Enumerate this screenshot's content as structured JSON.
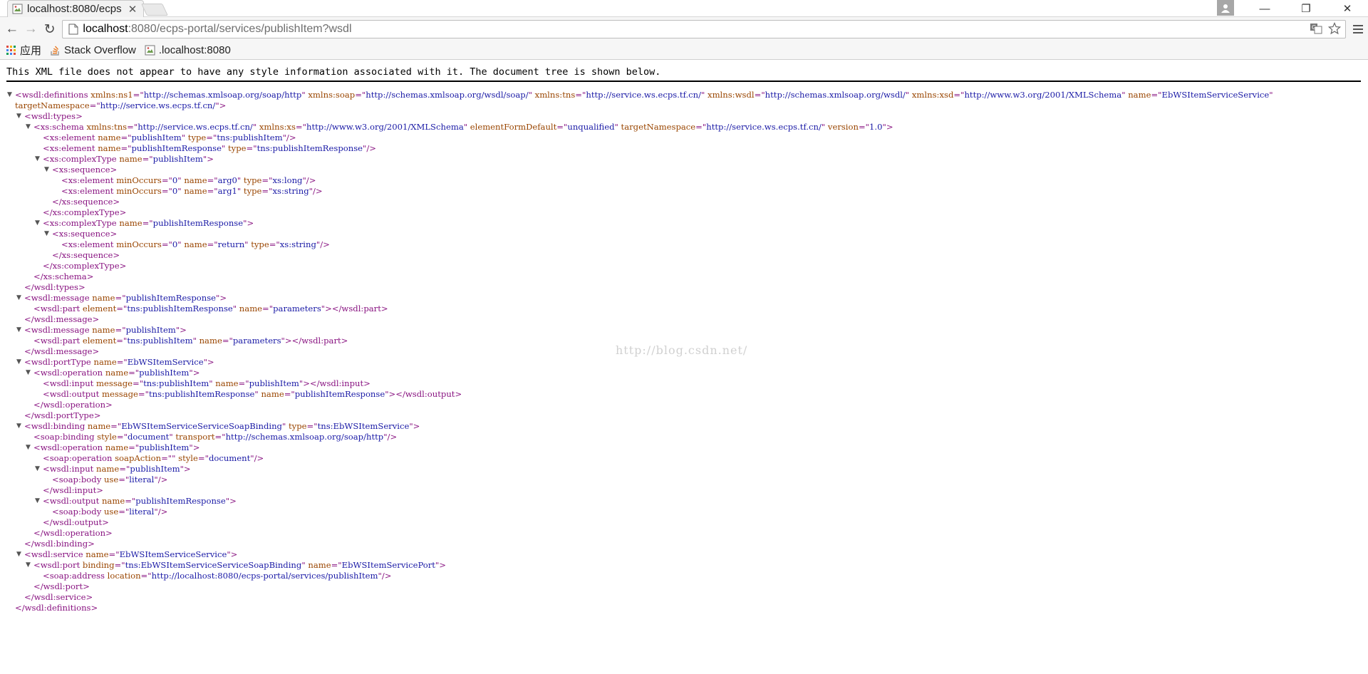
{
  "tab": {
    "title": "localhost:8080/ecps",
    "close_glyph": "✕"
  },
  "window_controls": {
    "minimize": "—",
    "restore": "❐",
    "close": "✕"
  },
  "toolbar": {
    "back_glyph": "←",
    "forward_glyph": "→",
    "reload_glyph": "↻",
    "url_host": "localhost",
    "url_path": ":8080/ecps-portal/services/publishItem?wsdl"
  },
  "bookmarks": [
    {
      "label": "应用",
      "icon": "apps-grid-icon"
    },
    {
      "label": "Stack Overflow",
      "icon": "stackoverflow-icon"
    },
    {
      "label": ".localhost:8080",
      "icon": "broken-image-icon"
    }
  ],
  "notice": "This XML file does not appear to have any style information associated with it. The document tree is shown below.",
  "watermark": "http://blog.csdn.net/",
  "colors": {
    "tag": "#881280",
    "attr_name": "#994500",
    "attr_value": "#1a1aa6"
  },
  "xml_lines": [
    {
      "indent": 0,
      "toggle": true,
      "parts": [
        [
          "t",
          "<wsdl:definitions"
        ],
        [
          "n",
          " xmlns:ns1"
        ],
        [
          "t",
          "=\""
        ],
        [
          "v",
          "http://schemas.xmlsoap.org/soap/http"
        ],
        [
          "t",
          "\""
        ],
        [
          "n",
          " xmlns:soap"
        ],
        [
          "t",
          "=\""
        ],
        [
          "v",
          "http://schemas.xmlsoap.org/wsdl/soap/"
        ],
        [
          "t",
          "\""
        ],
        [
          "n",
          " xmlns:tns"
        ],
        [
          "t",
          "=\""
        ],
        [
          "v",
          "http://service.ws.ecps.tf.cn/"
        ],
        [
          "t",
          "\""
        ],
        [
          "n",
          " xmlns:wsdl"
        ],
        [
          "t",
          "=\""
        ],
        [
          "v",
          "http://schemas.xmlsoap.org/wsdl/"
        ],
        [
          "t",
          "\""
        ],
        [
          "n",
          " xmlns:xsd"
        ],
        [
          "t",
          "=\""
        ],
        [
          "v",
          "http://www.w3.org/2001/XMLSchema"
        ],
        [
          "t",
          "\""
        ],
        [
          "n",
          " name"
        ],
        [
          "t",
          "=\""
        ],
        [
          "v",
          "EbWSItemServiceService"
        ],
        [
          "t",
          "\""
        ]
      ]
    },
    {
      "indent": 0,
      "toggle": false,
      "parts": [
        [
          "n",
          "targetNamespace"
        ],
        [
          "t",
          "=\""
        ],
        [
          "v",
          "http://service.ws.ecps.tf.cn/"
        ],
        [
          "t",
          "\">"
        ]
      ]
    },
    {
      "indent": 1,
      "toggle": true,
      "parts": [
        [
          "t",
          "<wsdl:types>"
        ]
      ]
    },
    {
      "indent": 2,
      "toggle": true,
      "parts": [
        [
          "t",
          "<xs:schema"
        ],
        [
          "n",
          " xmlns:tns"
        ],
        [
          "t",
          "=\""
        ],
        [
          "v",
          "http://service.ws.ecps.tf.cn/"
        ],
        [
          "t",
          "\""
        ],
        [
          "n",
          " xmlns:xs"
        ],
        [
          "t",
          "=\""
        ],
        [
          "v",
          "http://www.w3.org/2001/XMLSchema"
        ],
        [
          "t",
          "\""
        ],
        [
          "n",
          " elementFormDefault"
        ],
        [
          "t",
          "=\""
        ],
        [
          "v",
          "unqualified"
        ],
        [
          "t",
          "\""
        ],
        [
          "n",
          " targetNamespace"
        ],
        [
          "t",
          "=\""
        ],
        [
          "v",
          "http://service.ws.ecps.tf.cn/"
        ],
        [
          "t",
          "\""
        ],
        [
          "n",
          " version"
        ],
        [
          "t",
          "=\""
        ],
        [
          "v",
          "1.0"
        ],
        [
          "t",
          "\">"
        ]
      ]
    },
    {
      "indent": 3,
      "toggle": false,
      "parts": [
        [
          "t",
          "<xs:element"
        ],
        [
          "n",
          " name"
        ],
        [
          "t",
          "=\""
        ],
        [
          "v",
          "publishItem"
        ],
        [
          "t",
          "\""
        ],
        [
          "n",
          " type"
        ],
        [
          "t",
          "=\""
        ],
        [
          "v",
          "tns:publishItem"
        ],
        [
          "t",
          "\"/>"
        ]
      ]
    },
    {
      "indent": 3,
      "toggle": false,
      "parts": [
        [
          "t",
          "<xs:element"
        ],
        [
          "n",
          " name"
        ],
        [
          "t",
          "=\""
        ],
        [
          "v",
          "publishItemResponse"
        ],
        [
          "t",
          "\""
        ],
        [
          "n",
          " type"
        ],
        [
          "t",
          "=\""
        ],
        [
          "v",
          "tns:publishItemResponse"
        ],
        [
          "t",
          "\"/>"
        ]
      ]
    },
    {
      "indent": 3,
      "toggle": true,
      "parts": [
        [
          "t",
          "<xs:complexType"
        ],
        [
          "n",
          " name"
        ],
        [
          "t",
          "=\""
        ],
        [
          "v",
          "publishItem"
        ],
        [
          "t",
          "\">"
        ]
      ]
    },
    {
      "indent": 4,
      "toggle": true,
      "parts": [
        [
          "t",
          "<xs:sequence>"
        ]
      ]
    },
    {
      "indent": 5,
      "toggle": false,
      "parts": [
        [
          "t",
          "<xs:element"
        ],
        [
          "n",
          " minOccurs"
        ],
        [
          "t",
          "=\""
        ],
        [
          "v",
          "0"
        ],
        [
          "t",
          "\""
        ],
        [
          "n",
          " name"
        ],
        [
          "t",
          "=\""
        ],
        [
          "v",
          "arg0"
        ],
        [
          "t",
          "\""
        ],
        [
          "n",
          " type"
        ],
        [
          "t",
          "=\""
        ],
        [
          "v",
          "xs:long"
        ],
        [
          "t",
          "\"/>"
        ]
      ]
    },
    {
      "indent": 5,
      "toggle": false,
      "parts": [
        [
          "t",
          "<xs:element"
        ],
        [
          "n",
          " minOccurs"
        ],
        [
          "t",
          "=\""
        ],
        [
          "v",
          "0"
        ],
        [
          "t",
          "\""
        ],
        [
          "n",
          " name"
        ],
        [
          "t",
          "=\""
        ],
        [
          "v",
          "arg1"
        ],
        [
          "t",
          "\""
        ],
        [
          "n",
          " type"
        ],
        [
          "t",
          "=\""
        ],
        [
          "v",
          "xs:string"
        ],
        [
          "t",
          "\"/>"
        ]
      ]
    },
    {
      "indent": 4,
      "toggle": false,
      "parts": [
        [
          "t",
          "</xs:sequence>"
        ]
      ]
    },
    {
      "indent": 3,
      "toggle": false,
      "parts": [
        [
          "t",
          "</xs:complexType>"
        ]
      ]
    },
    {
      "indent": 3,
      "toggle": true,
      "parts": [
        [
          "t",
          "<xs:complexType"
        ],
        [
          "n",
          " name"
        ],
        [
          "t",
          "=\""
        ],
        [
          "v",
          "publishItemResponse"
        ],
        [
          "t",
          "\">"
        ]
      ]
    },
    {
      "indent": 4,
      "toggle": true,
      "parts": [
        [
          "t",
          "<xs:sequence>"
        ]
      ]
    },
    {
      "indent": 5,
      "toggle": false,
      "parts": [
        [
          "t",
          "<xs:element"
        ],
        [
          "n",
          " minOccurs"
        ],
        [
          "t",
          "=\""
        ],
        [
          "v",
          "0"
        ],
        [
          "t",
          "\""
        ],
        [
          "n",
          " name"
        ],
        [
          "t",
          "=\""
        ],
        [
          "v",
          "return"
        ],
        [
          "t",
          "\""
        ],
        [
          "n",
          " type"
        ],
        [
          "t",
          "=\""
        ],
        [
          "v",
          "xs:string"
        ],
        [
          "t",
          "\"/>"
        ]
      ]
    },
    {
      "indent": 4,
      "toggle": false,
      "parts": [
        [
          "t",
          "</xs:sequence>"
        ]
      ]
    },
    {
      "indent": 3,
      "toggle": false,
      "parts": [
        [
          "t",
          "</xs:complexType>"
        ]
      ]
    },
    {
      "indent": 2,
      "toggle": false,
      "parts": [
        [
          "t",
          "</xs:schema>"
        ]
      ]
    },
    {
      "indent": 1,
      "toggle": false,
      "parts": [
        [
          "t",
          "</wsdl:types>"
        ]
      ]
    },
    {
      "indent": 1,
      "toggle": true,
      "parts": [
        [
          "t",
          "<wsdl:message"
        ],
        [
          "n",
          " name"
        ],
        [
          "t",
          "=\""
        ],
        [
          "v",
          "publishItemResponse"
        ],
        [
          "t",
          "\">"
        ]
      ]
    },
    {
      "indent": 2,
      "toggle": false,
      "parts": [
        [
          "t",
          "<wsdl:part"
        ],
        [
          "n",
          " element"
        ],
        [
          "t",
          "=\""
        ],
        [
          "v",
          "tns:publishItemResponse"
        ],
        [
          "t",
          "\""
        ],
        [
          "n",
          " name"
        ],
        [
          "t",
          "=\""
        ],
        [
          "v",
          "parameters"
        ],
        [
          "t",
          "\"></wsdl:part>"
        ]
      ]
    },
    {
      "indent": 1,
      "toggle": false,
      "parts": [
        [
          "t",
          "</wsdl:message>"
        ]
      ]
    },
    {
      "indent": 1,
      "toggle": true,
      "parts": [
        [
          "t",
          "<wsdl:message"
        ],
        [
          "n",
          " name"
        ],
        [
          "t",
          "=\""
        ],
        [
          "v",
          "publishItem"
        ],
        [
          "t",
          "\">"
        ]
      ]
    },
    {
      "indent": 2,
      "toggle": false,
      "parts": [
        [
          "t",
          "<wsdl:part"
        ],
        [
          "n",
          " element"
        ],
        [
          "t",
          "=\""
        ],
        [
          "v",
          "tns:publishItem"
        ],
        [
          "t",
          "\""
        ],
        [
          "n",
          " name"
        ],
        [
          "t",
          "=\""
        ],
        [
          "v",
          "parameters"
        ],
        [
          "t",
          "\"></wsdl:part>"
        ]
      ]
    },
    {
      "indent": 1,
      "toggle": false,
      "parts": [
        [
          "t",
          "</wsdl:message>"
        ]
      ]
    },
    {
      "indent": 1,
      "toggle": true,
      "parts": [
        [
          "t",
          "<wsdl:portType"
        ],
        [
          "n",
          " name"
        ],
        [
          "t",
          "=\""
        ],
        [
          "v",
          "EbWSItemService"
        ],
        [
          "t",
          "\">"
        ]
      ]
    },
    {
      "indent": 2,
      "toggle": true,
      "parts": [
        [
          "t",
          "<wsdl:operation"
        ],
        [
          "n",
          " name"
        ],
        [
          "t",
          "=\""
        ],
        [
          "v",
          "publishItem"
        ],
        [
          "t",
          "\">"
        ]
      ]
    },
    {
      "indent": 3,
      "toggle": false,
      "parts": [
        [
          "t",
          "<wsdl:input"
        ],
        [
          "n",
          " message"
        ],
        [
          "t",
          "=\""
        ],
        [
          "v",
          "tns:publishItem"
        ],
        [
          "t",
          "\""
        ],
        [
          "n",
          " name"
        ],
        [
          "t",
          "=\""
        ],
        [
          "v",
          "publishItem"
        ],
        [
          "t",
          "\"></wsdl:input>"
        ]
      ]
    },
    {
      "indent": 3,
      "toggle": false,
      "parts": [
        [
          "t",
          "<wsdl:output"
        ],
        [
          "n",
          " message"
        ],
        [
          "t",
          "=\""
        ],
        [
          "v",
          "tns:publishItemResponse"
        ],
        [
          "t",
          "\""
        ],
        [
          "n",
          " name"
        ],
        [
          "t",
          "=\""
        ],
        [
          "v",
          "publishItemResponse"
        ],
        [
          "t",
          "\"></wsdl:output>"
        ]
      ]
    },
    {
      "indent": 2,
      "toggle": false,
      "parts": [
        [
          "t",
          "</wsdl:operation>"
        ]
      ]
    },
    {
      "indent": 1,
      "toggle": false,
      "parts": [
        [
          "t",
          "</wsdl:portType>"
        ]
      ]
    },
    {
      "indent": 1,
      "toggle": true,
      "parts": [
        [
          "t",
          "<wsdl:binding"
        ],
        [
          "n",
          " name"
        ],
        [
          "t",
          "=\""
        ],
        [
          "v",
          "EbWSItemServiceServiceSoapBinding"
        ],
        [
          "t",
          "\""
        ],
        [
          "n",
          " type"
        ],
        [
          "t",
          "=\""
        ],
        [
          "v",
          "tns:EbWSItemService"
        ],
        [
          "t",
          "\">"
        ]
      ]
    },
    {
      "indent": 2,
      "toggle": false,
      "parts": [
        [
          "t",
          "<soap:binding"
        ],
        [
          "n",
          " style"
        ],
        [
          "t",
          "=\""
        ],
        [
          "v",
          "document"
        ],
        [
          "t",
          "\""
        ],
        [
          "n",
          " transport"
        ],
        [
          "t",
          "=\""
        ],
        [
          "v",
          "http://schemas.xmlsoap.org/soap/http"
        ],
        [
          "t",
          "\"/>"
        ]
      ]
    },
    {
      "indent": 2,
      "toggle": true,
      "parts": [
        [
          "t",
          "<wsdl:operation"
        ],
        [
          "n",
          " name"
        ],
        [
          "t",
          "=\""
        ],
        [
          "v",
          "publishItem"
        ],
        [
          "t",
          "\">"
        ]
      ]
    },
    {
      "indent": 3,
      "toggle": false,
      "parts": [
        [
          "t",
          "<soap:operation"
        ],
        [
          "n",
          " soapAction"
        ],
        [
          "t",
          "=\"\""
        ],
        [
          "n",
          " style"
        ],
        [
          "t",
          "=\""
        ],
        [
          "v",
          "document"
        ],
        [
          "t",
          "\"/>"
        ]
      ]
    },
    {
      "indent": 3,
      "toggle": true,
      "parts": [
        [
          "t",
          "<wsdl:input"
        ],
        [
          "n",
          " name"
        ],
        [
          "t",
          "=\""
        ],
        [
          "v",
          "publishItem"
        ],
        [
          "t",
          "\">"
        ]
      ]
    },
    {
      "indent": 4,
      "toggle": false,
      "parts": [
        [
          "t",
          "<soap:body"
        ],
        [
          "n",
          " use"
        ],
        [
          "t",
          "=\""
        ],
        [
          "v",
          "literal"
        ],
        [
          "t",
          "\"/>"
        ]
      ]
    },
    {
      "indent": 3,
      "toggle": false,
      "parts": [
        [
          "t",
          "</wsdl:input>"
        ]
      ]
    },
    {
      "indent": 3,
      "toggle": true,
      "parts": [
        [
          "t",
          "<wsdl:output"
        ],
        [
          "n",
          " name"
        ],
        [
          "t",
          "=\""
        ],
        [
          "v",
          "publishItemResponse"
        ],
        [
          "t",
          "\">"
        ]
      ]
    },
    {
      "indent": 4,
      "toggle": false,
      "parts": [
        [
          "t",
          "<soap:body"
        ],
        [
          "n",
          " use"
        ],
        [
          "t",
          "=\""
        ],
        [
          "v",
          "literal"
        ],
        [
          "t",
          "\"/>"
        ]
      ]
    },
    {
      "indent": 3,
      "toggle": false,
      "parts": [
        [
          "t",
          "</wsdl:output>"
        ]
      ]
    },
    {
      "indent": 2,
      "toggle": false,
      "parts": [
        [
          "t",
          "</wsdl:operation>"
        ]
      ]
    },
    {
      "indent": 1,
      "toggle": false,
      "parts": [
        [
          "t",
          "</wsdl:binding>"
        ]
      ]
    },
    {
      "indent": 1,
      "toggle": true,
      "parts": [
        [
          "t",
          "<wsdl:service"
        ],
        [
          "n",
          " name"
        ],
        [
          "t",
          "=\""
        ],
        [
          "v",
          "EbWSItemServiceService"
        ],
        [
          "t",
          "\">"
        ]
      ]
    },
    {
      "indent": 2,
      "toggle": true,
      "parts": [
        [
          "t",
          "<wsdl:port"
        ],
        [
          "n",
          " binding"
        ],
        [
          "t",
          "=\""
        ],
        [
          "v",
          "tns:EbWSItemServiceServiceSoapBinding"
        ],
        [
          "t",
          "\""
        ],
        [
          "n",
          " name"
        ],
        [
          "t",
          "=\""
        ],
        [
          "v",
          "EbWSItemServicePort"
        ],
        [
          "t",
          "\">"
        ]
      ]
    },
    {
      "indent": 3,
      "toggle": false,
      "parts": [
        [
          "t",
          "<soap:address"
        ],
        [
          "n",
          " location"
        ],
        [
          "t",
          "=\""
        ],
        [
          "v",
          "http://localhost:8080/ecps-portal/services/publishItem"
        ],
        [
          "t",
          "\"/>"
        ]
      ]
    },
    {
      "indent": 2,
      "toggle": false,
      "parts": [
        [
          "t",
          "</wsdl:port>"
        ]
      ]
    },
    {
      "indent": 1,
      "toggle": false,
      "parts": [
        [
          "t",
          "</wsdl:service>"
        ]
      ]
    },
    {
      "indent": 0,
      "toggle": false,
      "parts": [
        [
          "t",
          "</wsdl:definitions>"
        ]
      ]
    }
  ]
}
